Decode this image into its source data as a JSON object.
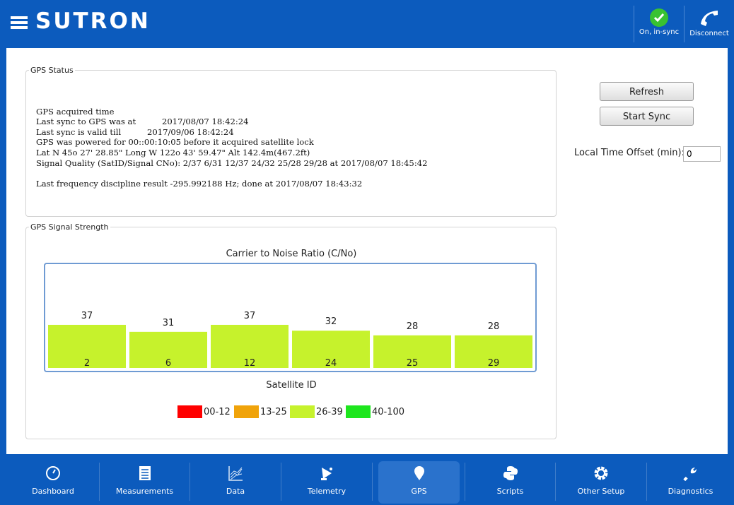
{
  "header": {
    "logo": "SUTRON",
    "sync_status": "On, in-sync",
    "disconnect_label": "Disconnect",
    "colors": {
      "bar": "#0c5bbd",
      "sync_ok": "#39c232"
    }
  },
  "gps_status": {
    "legend": "GPS Status",
    "lines": [
      "GPS acquired time",
      "Last sync to GPS was at          2017/08/07 18:42:24",
      "Last sync is valid till          2017/09/06 18:42:24",
      "GPS was powered for 00::00:10:05 before it acquired satellite lock",
      "Lat N 45o 27' 28.85\" Long W 122o 43' 59.47\" Alt 142.4m(467.2ft)",
      "Signal Quality (SatID/Signal CNo): 2/37 6/31 12/37 24/32 25/28 29/28 at 2017/08/07 18:45:42",
      "",
      "Last frequency discipline result -295.992188 Hz; done at 2017/08/07 18:43:32"
    ]
  },
  "controls": {
    "refresh_label": "Refresh",
    "start_sync_label": "Start Sync",
    "offset_label": "Local Time Offset (min):",
    "offset_value": "0"
  },
  "signal_strength": {
    "legend": "GPS Signal Strength"
  },
  "chart_data": {
    "type": "bar",
    "title": "Carrier to Noise Ratio (C/No)",
    "xlabel": "Satellite ID",
    "ylabel": "",
    "ylim": [
      0,
      100
    ],
    "categories": [
      "2",
      "6",
      "12",
      "24",
      "25",
      "29"
    ],
    "values": [
      37,
      31,
      37,
      32,
      28,
      28
    ],
    "legend": [
      {
        "label": "00-12",
        "color": "#ff0000"
      },
      {
        "label": "13-25",
        "color": "#f0a30a"
      },
      {
        "label": "26-39",
        "color": "#c6f22c"
      },
      {
        "label": "40-100",
        "color": "#1ee61e"
      }
    ]
  },
  "nav": {
    "items": [
      {
        "label": "Dashboard",
        "icon": "gauge-icon"
      },
      {
        "label": "Measurements",
        "icon": "list-icon"
      },
      {
        "label": "Data",
        "icon": "graph-icon"
      },
      {
        "label": "Telemetry",
        "icon": "satellite-icon"
      },
      {
        "label": "GPS",
        "icon": "location-pin-icon",
        "active": true
      },
      {
        "label": "Scripts",
        "icon": "python-icon"
      },
      {
        "label": "Other Setup",
        "icon": "gear-icon"
      },
      {
        "label": "Diagnostics",
        "icon": "wrench-icon"
      }
    ]
  }
}
